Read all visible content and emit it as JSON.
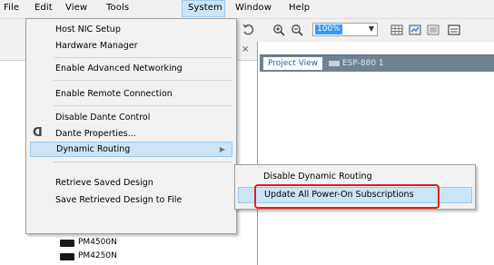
{
  "menubar": {
    "file": "File",
    "edit": "Edit",
    "view": "View",
    "tools": "Tools",
    "system": "System",
    "window": "Window",
    "help": "Help"
  },
  "toolbar": {
    "zoom_value": "100%",
    "icons": [
      "rotate-icon",
      "zoom-in-icon",
      "zoom-out-icon",
      "grid-icon",
      "fit-icon",
      "panel-icon",
      "window-icon"
    ]
  },
  "system_menu": {
    "items": [
      {
        "label": "Host NIC Setup"
      },
      {
        "label": "Hardware Manager"
      },
      {
        "label": "Enable Advanced Networking"
      },
      {
        "label": "Enable Remote Connection"
      },
      {
        "label": "Disable Dante Control"
      },
      {
        "label": "Dante Properties..."
      },
      {
        "label": "Dynamic Routing"
      },
      {
        "label": "Retrieve Saved Design"
      },
      {
        "label": "Save Retrieved Design to File"
      }
    ],
    "submenu_arrow": "▶"
  },
  "dynamic_routing_submenu": {
    "items": [
      {
        "label": "Disable Dynamic Routing"
      },
      {
        "label": "Update All Power-On Subscriptions"
      }
    ]
  },
  "project": {
    "active_tab": "Project View",
    "device_tab": "ESP-880 1",
    "close_glyph": "×"
  },
  "tree": {
    "items": [
      {
        "label": "PM4500N"
      },
      {
        "label": "PM4250N"
      }
    ]
  },
  "colors": {
    "highlight": "#cce4f7",
    "highlight_border": "#99c9ef",
    "annotation_red": "#e0201b",
    "tab_strip": "#6e8296"
  }
}
